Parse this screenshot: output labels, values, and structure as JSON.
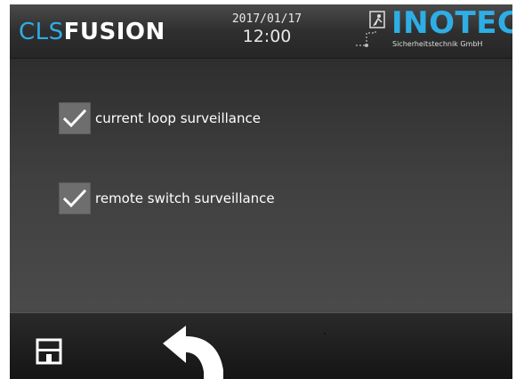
{
  "header": {
    "brand_part1": "CLS",
    "brand_part2": "FUSION",
    "date": "2017/01/17",
    "time": "12:00",
    "logo_text": "INOTEC",
    "logo_subtitle": "Sicherheitstechnik GmbH"
  },
  "options": [
    {
      "label": "current loop surveillance",
      "checked": true
    },
    {
      "label": "remote switch surveillance",
      "checked": true
    }
  ],
  "toolbar": {
    "save_icon": "save-icon",
    "back_icon": "back-arrow-icon"
  },
  "colors": {
    "accent": "#2eaee6",
    "background": "#3a3a3a",
    "checkbox": "#6e6e6e"
  }
}
